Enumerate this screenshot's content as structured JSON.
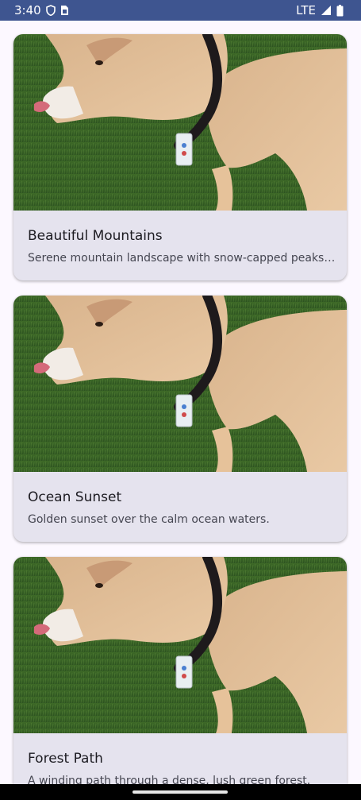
{
  "status_bar": {
    "time": "3:40",
    "network": "LTE",
    "icons": [
      "shield-icon",
      "sim-card-icon",
      "signal-icon",
      "battery-icon"
    ],
    "background": "#3E5590"
  },
  "cards": [
    {
      "title": "Beautiful Mountains",
      "description": "Serene mountain landscape with snow-capped peaks and clear blue sky.",
      "image": "dog-on-grass-photo"
    },
    {
      "title": "Ocean Sunset",
      "description": "Golden sunset over the calm ocean waters.",
      "image": "dog-on-grass-photo"
    },
    {
      "title": "Forest Path",
      "description": "A winding path through a dense, lush green forest.",
      "image": "dog-on-grass-photo"
    }
  ],
  "colors": {
    "background": "#FCF8FF",
    "card": "#E5E3EE",
    "title": "#1C1B21",
    "description": "#454651"
  }
}
